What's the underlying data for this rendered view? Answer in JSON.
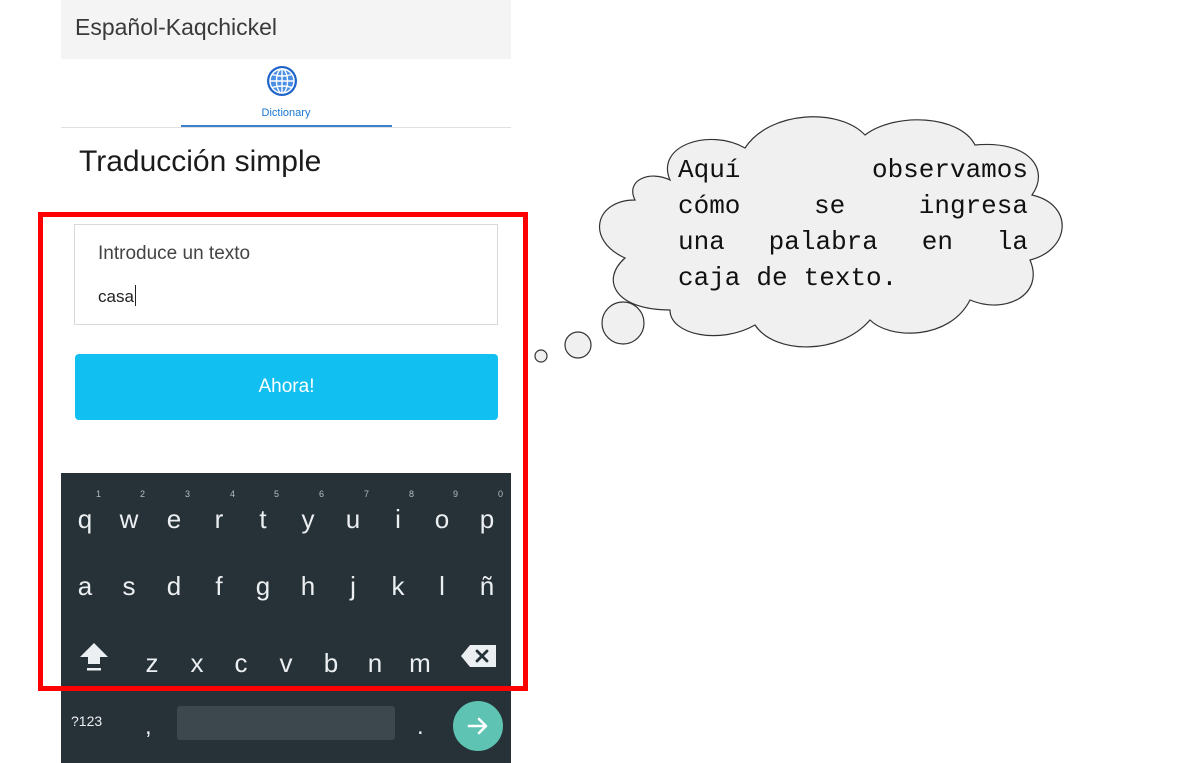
{
  "app": {
    "title": "Español-Kaqchickel"
  },
  "tabs": {
    "active_label": "Dictionary"
  },
  "page": {
    "heading": "Traducción simple"
  },
  "input": {
    "label": "Introduce un texto",
    "value": "casa"
  },
  "submit_button": {
    "label": "Ahora!"
  },
  "keyboard": {
    "row1": [
      "q",
      "w",
      "e",
      "r",
      "t",
      "y",
      "u",
      "i",
      "o",
      "p"
    ],
    "row1_hints": [
      "1",
      "2",
      "3",
      "4",
      "5",
      "6",
      "7",
      "8",
      "9",
      "0"
    ],
    "row2": [
      "a",
      "s",
      "d",
      "f",
      "g",
      "h",
      "j",
      "k",
      "l",
      "ñ"
    ],
    "row3": [
      "z",
      "x",
      "c",
      "v",
      "b",
      "n",
      "m"
    ],
    "symbols_label": "?123",
    "comma": ",",
    "period": "."
  },
  "annotation": {
    "lines": [
      [
        "Aquí",
        "observamos"
      ],
      [
        "cómo",
        "se",
        "ingresa"
      ],
      [
        "una",
        "palabra",
        "en",
        "la"
      ],
      [
        "caja",
        "de",
        "texto."
      ]
    ]
  },
  "colors": {
    "button_bg": "#11bff0",
    "keyboard_bg": "#263238",
    "highlight_border": "#ff0000",
    "enter_key": "#5fc3b3",
    "cloud_fill": "#f0f0f0"
  },
  "icons": {
    "tab": "globe-icon",
    "shift": "shift-arrow-icon",
    "backspace": "backspace-icon",
    "enter": "arrow-right-icon"
  }
}
